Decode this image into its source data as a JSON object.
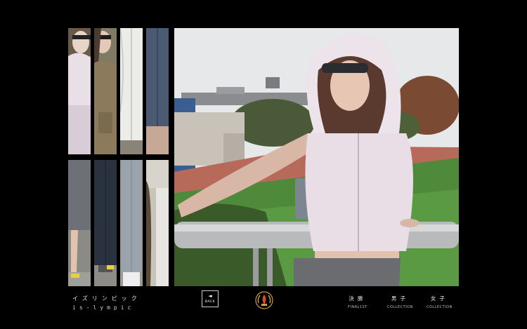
{
  "brand": {
    "title_jp": "イズリンピック",
    "title_en": "is-lympic"
  },
  "back_button": {
    "arrow": "◄",
    "label": "BACK"
  },
  "emblem": {
    "icon": "laurel-flame-emblem",
    "colors": [
      "#c8a040",
      "#d84a20"
    ]
  },
  "nav": [
    {
      "jp": "決勝",
      "en": "FINAL1ST"
    },
    {
      "jp": "男子",
      "en": "COLLECTION"
    },
    {
      "jp": "女子",
      "en": "COLLECTION"
    }
  ],
  "thumbnails": {
    "count": 8,
    "rows": 2,
    "columns": 4
  },
  "hero": {
    "subject": "woman in white hooded vest and sunglasses leaning on railing at stadium"
  }
}
